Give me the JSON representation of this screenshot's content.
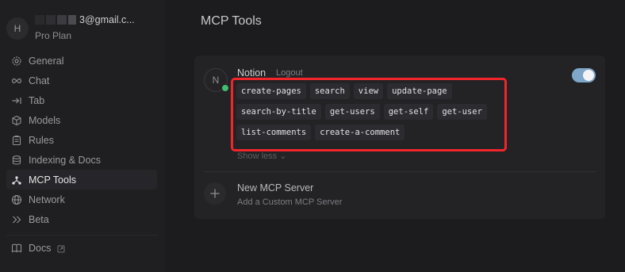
{
  "account": {
    "avatar_initial": "H",
    "email": "3@gmail.c...",
    "plan": "Pro Plan"
  },
  "nav": {
    "items": [
      {
        "label": "General",
        "icon": "gear-icon"
      },
      {
        "label": "Chat",
        "icon": "infinity-icon"
      },
      {
        "label": "Tab",
        "icon": "arrow-to-line-icon"
      },
      {
        "label": "Models",
        "icon": "cube-icon"
      },
      {
        "label": "Rules",
        "icon": "clipboard-icon"
      },
      {
        "label": "Indexing & Docs",
        "icon": "database-icon"
      },
      {
        "label": "MCP Tools",
        "icon": "network-node-icon",
        "active": true
      },
      {
        "label": "Network",
        "icon": "globe-icon"
      },
      {
        "label": "Beta",
        "icon": "double-chevron-right-icon"
      }
    ],
    "docs": {
      "label": "Docs",
      "icon": "book-icon"
    }
  },
  "page": {
    "title": "MCP Tools"
  },
  "server": {
    "avatar_initial": "N",
    "name": "Notion",
    "logout_label": "Logout",
    "enabled": true,
    "status_color": "#3fbf6f",
    "tool_rows": [
      [
        "create-pages",
        "search",
        "view",
        "update-page"
      ],
      [
        "search-by-title",
        "get-users",
        "get-self",
        "get-user"
      ],
      [
        "list-comments",
        "create-a-comment"
      ]
    ],
    "show_less_label": "Show less ⌄"
  },
  "new_server": {
    "title": "New MCP Server",
    "subtitle": "Add a Custom MCP Server"
  },
  "colors": {
    "accent_toggle": "#7ea7c9",
    "highlight_border": "#f0262b"
  }
}
